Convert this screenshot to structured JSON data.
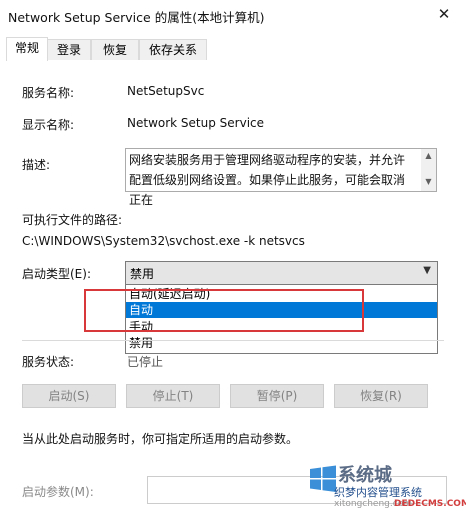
{
  "window": {
    "title": "Network Setup Service 的属性(本地计算机)",
    "close_glyph": "✕"
  },
  "tabs": [
    {
      "label": "常规"
    },
    {
      "label": "登录"
    },
    {
      "label": "恢复"
    },
    {
      "label": "依存关系"
    }
  ],
  "general": {
    "service_name_label": "服务名称:",
    "service_name_value": "NetSetupSvc",
    "display_name_label": "显示名称:",
    "display_name_value": "Network Setup Service",
    "description_label": "描述:",
    "description_text": "网络安装服务用于管理网络驱动程序的安装，并允许配置低级别网络设置。如果停止此服务，可能会取消正在",
    "path_label": "可执行文件的路径:",
    "path_value": "C:\\WINDOWS\\System32\\svchost.exe -k netsvcs",
    "startup_type_label": "启动类型(E):",
    "startup_type_value": "禁用",
    "startup_options": [
      {
        "label": "自动(延迟启动)",
        "selected": false
      },
      {
        "label": "自动",
        "selected": true
      },
      {
        "label": "手动",
        "selected": false
      },
      {
        "label": "禁用",
        "selected": false
      }
    ],
    "status_label": "服务状态:",
    "status_value": "已停止",
    "buttons": {
      "start": "启动(S)",
      "stop": "停止(T)",
      "pause": "暂停(P)",
      "resume": "恢复(R)"
    },
    "hint_text": "当从此处启动服务时，你可指定所适用的启动参数。",
    "start_params_label": "启动参数(M):"
  },
  "watermark": {
    "title": "系统城",
    "subtitle": "织梦内容管理系统",
    "url_left": "xitongcheng.com",
    "url_right": "DEDECMS.COM"
  },
  "colors": {
    "accent": "#0078d7",
    "highlight_box": "#d9383a"
  }
}
